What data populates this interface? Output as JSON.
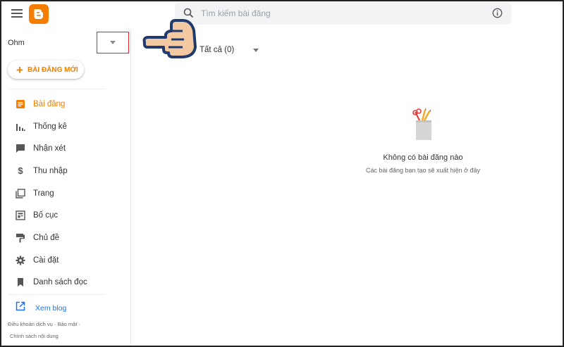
{
  "header": {
    "search_placeholder": "Tìm kiếm bài đăng"
  },
  "sidebar": {
    "blog_name": "Ohm",
    "new_post_label": "BÀI ĐĂNG MỚI",
    "items": [
      {
        "label": "Bài đăng",
        "icon": "posts-icon",
        "active": true
      },
      {
        "label": "Thống kê",
        "icon": "stats-icon"
      },
      {
        "label": "Nhận xét",
        "icon": "comment-icon"
      },
      {
        "label": "Thu nhập",
        "icon": "dollar-icon"
      },
      {
        "label": "Trang",
        "icon": "pages-icon"
      },
      {
        "label": "Bố cục",
        "icon": "layout-icon"
      },
      {
        "label": "Chủ đề",
        "icon": "theme-icon"
      },
      {
        "label": "Cài đặt",
        "icon": "gear-icon"
      },
      {
        "label": "Danh sách đọc",
        "icon": "bookmark-icon"
      }
    ],
    "view_blog_label": "Xem blog",
    "footer_terms": "Điều khoản dịch vụ",
    "footer_privacy": "Bảo mật",
    "footer_content_policy": "Chính sách nội dung"
  },
  "main": {
    "filter_label": "Tất cả (0)",
    "empty_title": "Không có bài đăng nào",
    "empty_subtitle": "Các bài đăng bạn tạo sẽ xuất hiện ở đây"
  },
  "colors": {
    "accent": "#f57d00",
    "link": "#1a73e8",
    "highlight_box": "#e0242b"
  }
}
